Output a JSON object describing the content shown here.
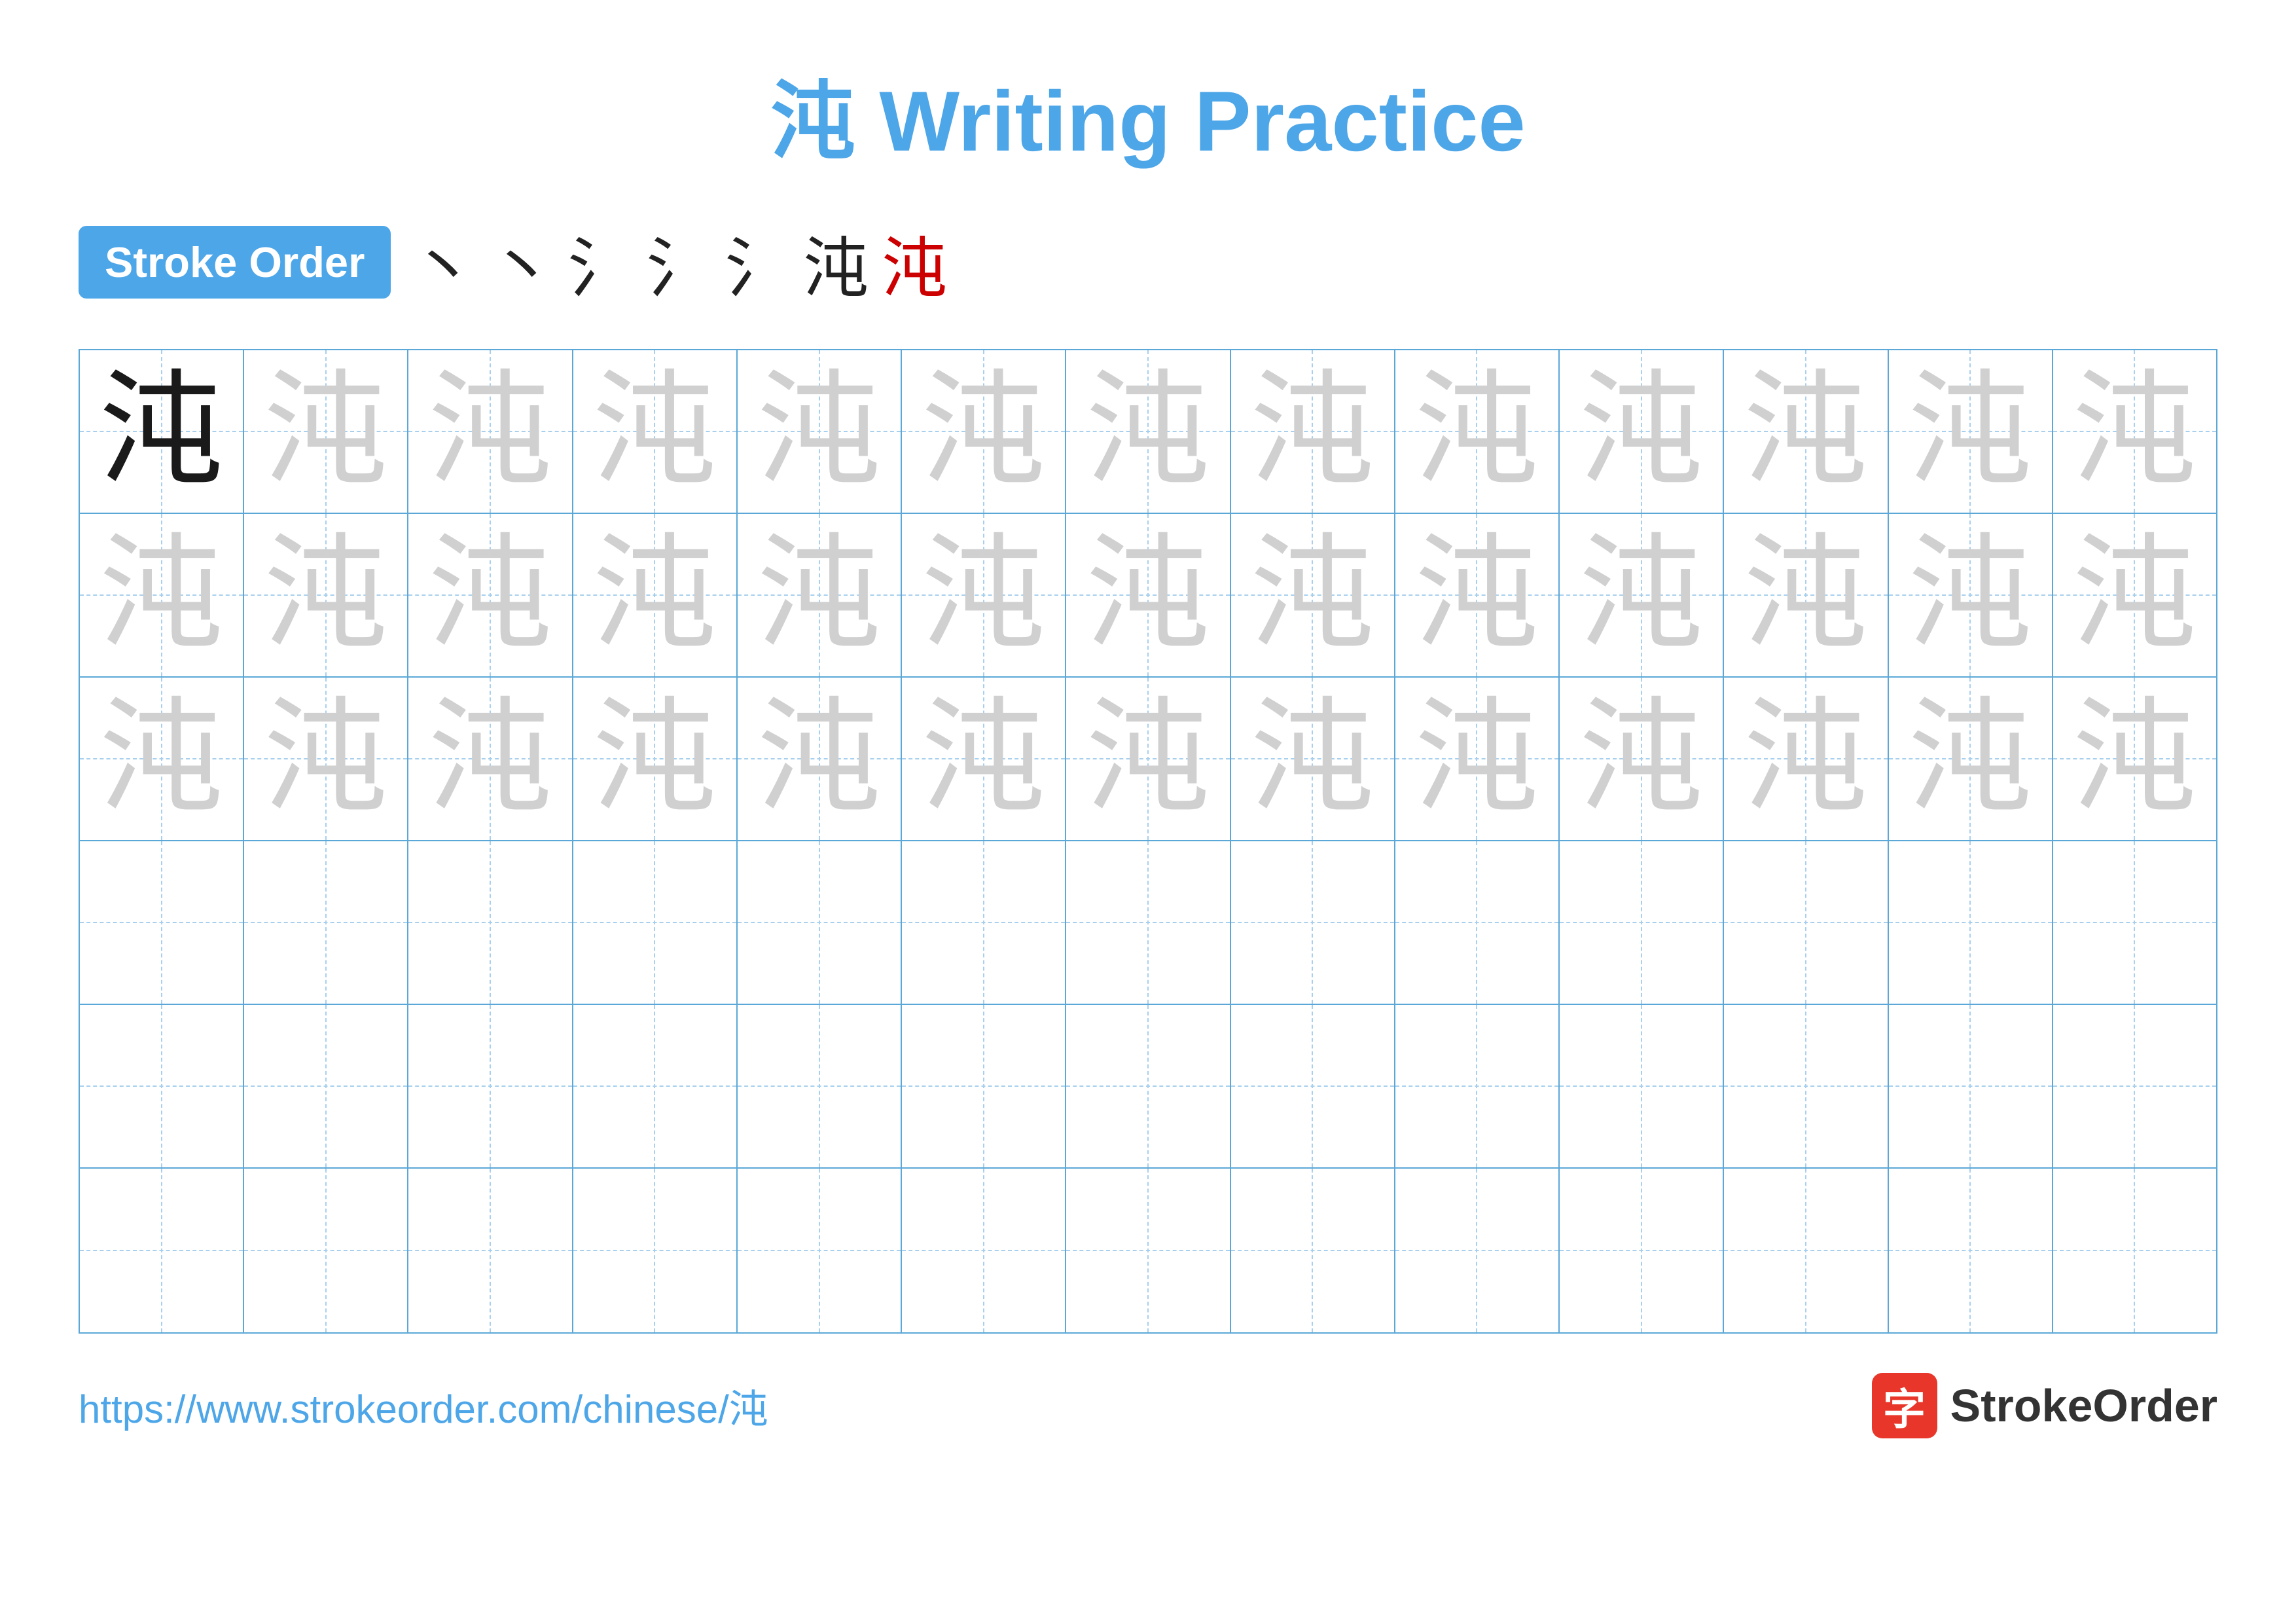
{
  "title": {
    "character": "沌",
    "suffix": " Writing Practice",
    "color": "#4DA6E8"
  },
  "stroke_order": {
    "badge_label": "Stroke Order",
    "strokes": [
      "丶",
      "丶",
      "氵",
      "氵",
      "氵",
      "沌",
      "沌"
    ],
    "stroke_colors": [
      "black",
      "black",
      "black",
      "black",
      "black",
      "black",
      "red"
    ]
  },
  "grid": {
    "rows": 6,
    "cols": 13,
    "row_types": [
      "dark-then-light",
      "light",
      "light",
      "empty",
      "empty",
      "empty"
    ],
    "character": "沌"
  },
  "footer": {
    "url": "https://www.strokeorder.com/chinese/沌",
    "logo_char": "字",
    "logo_name": "StrokeOrder"
  }
}
